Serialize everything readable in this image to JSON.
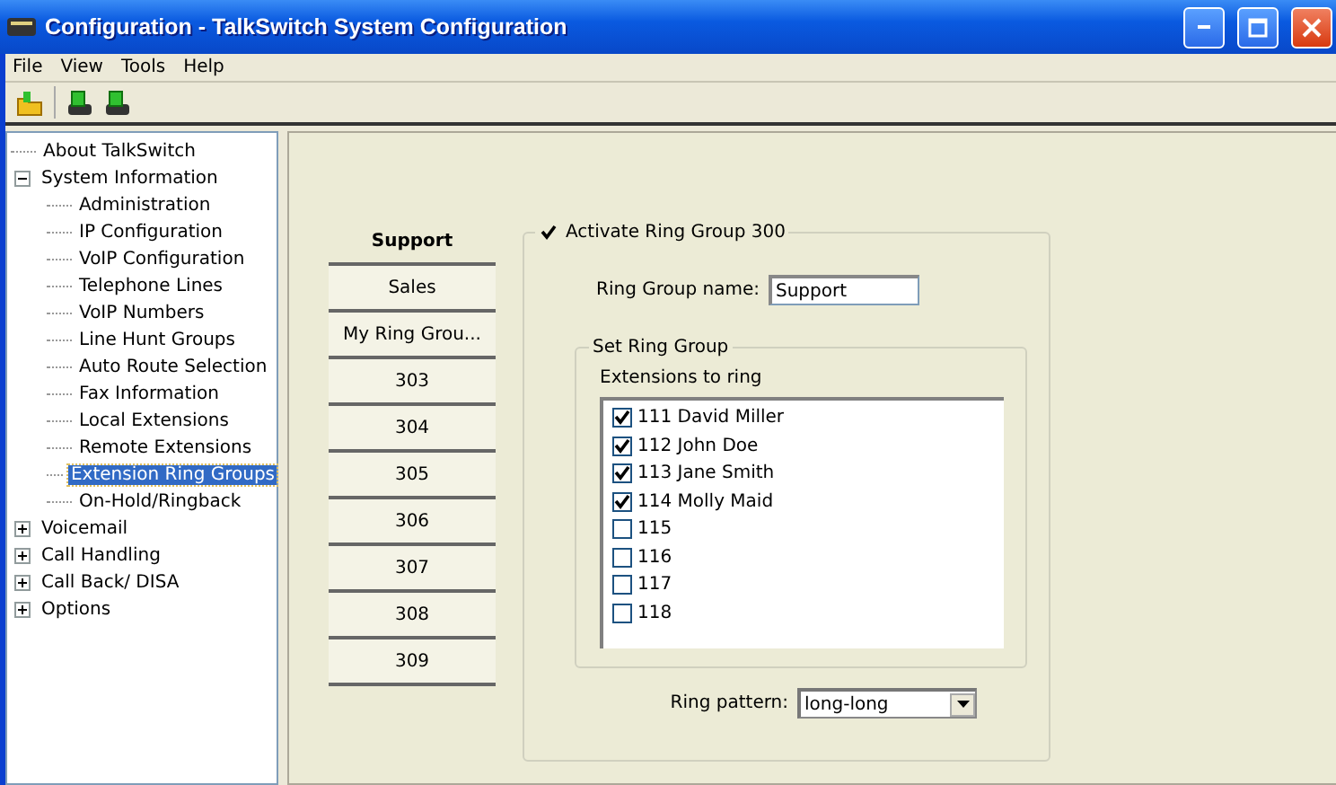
{
  "window": {
    "title": "Configuration - TalkSwitch System Configuration"
  },
  "menu": [
    {
      "label": "File"
    },
    {
      "label": "View"
    },
    {
      "label": "Tools"
    },
    {
      "label": "Help"
    }
  ],
  "tree": [
    {
      "label": "About TalkSwitch",
      "selected": false
    },
    {
      "label": "System Information",
      "expanded": true,
      "selected": false,
      "children": [
        {
          "label": "Administration",
          "selected": false
        },
        {
          "label": "IP Configuration",
          "selected": false
        },
        {
          "label": "VoIP Configuration",
          "selected": false
        },
        {
          "label": "Telephone Lines",
          "selected": false
        },
        {
          "label": "VoIP Numbers",
          "selected": false
        },
        {
          "label": "Line Hunt Groups",
          "selected": false
        },
        {
          "label": "Auto Route Selection",
          "selected": false
        },
        {
          "label": "Fax Information",
          "selected": false
        },
        {
          "label": "Local Extensions",
          "selected": false
        },
        {
          "label": "Remote Extensions",
          "selected": false
        },
        {
          "label": "Extension Ring Groups",
          "selected": true
        },
        {
          "label": "On-Hold/Ringback",
          "selected": false
        }
      ]
    },
    {
      "label": "Voicemail",
      "expanded": false,
      "selected": false
    },
    {
      "label": "Call Handling",
      "expanded": false,
      "selected": false
    },
    {
      "label": "Call Back/ DISA",
      "expanded": false,
      "selected": false
    },
    {
      "label": "Options",
      "expanded": false,
      "selected": false
    }
  ],
  "group_tabs": [
    {
      "label": "Support",
      "selected": true
    },
    {
      "label": "Sales",
      "selected": false
    },
    {
      "label": "My Ring Grou...",
      "selected": false
    },
    {
      "label": "303",
      "selected": false
    },
    {
      "label": "304",
      "selected": false
    },
    {
      "label": "305",
      "selected": false
    },
    {
      "label": "306",
      "selected": false
    },
    {
      "label": "307",
      "selected": false
    },
    {
      "label": "308",
      "selected": false
    },
    {
      "label": "309",
      "selected": false
    }
  ],
  "activate": {
    "label": "Activate Ring Group 300",
    "checked": true
  },
  "name_field": {
    "label": "Ring Group name:",
    "value": "Support"
  },
  "set_ring_group": {
    "title": "Set Ring Group",
    "list_label": "Extensions to ring",
    "extensions": [
      {
        "label": "111 David Miller",
        "checked": true
      },
      {
        "label": "112 John Doe",
        "checked": true
      },
      {
        "label": "113 Jane Smith",
        "checked": true
      },
      {
        "label": "114 Molly Maid",
        "checked": true
      },
      {
        "label": "115",
        "checked": false
      },
      {
        "label": "116",
        "checked": false
      },
      {
        "label": "117",
        "checked": false
      },
      {
        "label": "118",
        "checked": false
      }
    ]
  },
  "ring_pattern": {
    "label": "Ring pattern:",
    "value": "long-long"
  }
}
